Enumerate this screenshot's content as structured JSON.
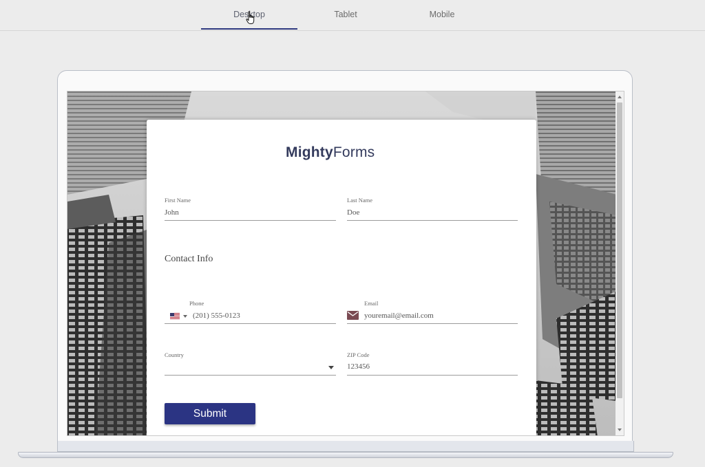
{
  "tabs": [
    {
      "label": "Desktop",
      "active": true
    },
    {
      "label": "Tablet",
      "active": false
    },
    {
      "label": "Mobile",
      "active": false
    }
  ],
  "form": {
    "logo_part1": "M",
    "logo_bold": "ighty",
    "logo_part2": "Forms",
    "first_name": {
      "label": "First Name",
      "value": "John"
    },
    "last_name": {
      "label": "Last Name",
      "value": "Doe"
    },
    "section_title": "Contact Info",
    "phone": {
      "label": "Phone",
      "value": "(201) 555-0123"
    },
    "email": {
      "label": "Email",
      "value": "youremail@email.com"
    },
    "country": {
      "label": "Country",
      "value": ""
    },
    "zip": {
      "label": "ZIP Code",
      "value": "123456"
    },
    "submit_label": "Submit"
  },
  "colors": {
    "accent": "#2b3483",
    "logo": "#333a5c"
  }
}
